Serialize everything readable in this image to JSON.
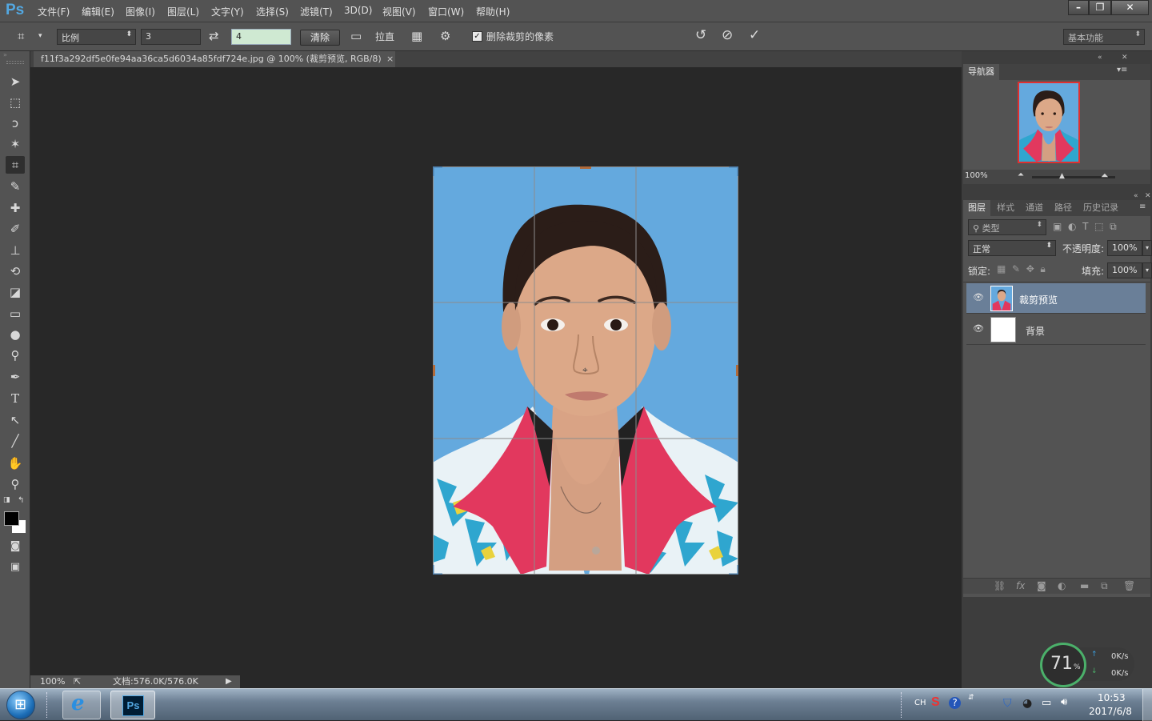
{
  "app": {
    "logo": "Ps"
  },
  "menu": [
    "文件(F)",
    "编辑(E)",
    "图像(I)",
    "图层(L)",
    "文字(Y)",
    "选择(S)",
    "滤镜(T)",
    "3D(D)",
    "视图(V)",
    "窗口(W)",
    "帮助(H)"
  ],
  "window_controls": {
    "minimize": "–",
    "restore": "❐",
    "close": "✕"
  },
  "options": {
    "ratio_select": "比例",
    "width_value": "3",
    "height_value": "4",
    "clear_label": "清除",
    "straighten_label": "拉直",
    "delete_cropped_label": "删除裁剪的像素",
    "delete_cropped_checked": true,
    "workspace_select": "基本功能"
  },
  "document": {
    "tab_title": "f11f3a292df5e0fe94aa36ca5d6034a85fdf724e.jpg @ 100% (裁剪预览, RGB/8)",
    "tab_close": "×"
  },
  "status": {
    "zoom": "100%",
    "doc_info": "文档:576.0K/576.0K"
  },
  "navigator": {
    "tab_label": "导航器",
    "zoom": "100%"
  },
  "layers_panel": {
    "tabs": [
      "图层",
      "样式",
      "通道",
      "路径",
      "历史记录"
    ],
    "filter_kind": "类型",
    "blend_mode": "正常",
    "opacity_label": "不透明度:",
    "opacity_value": "100%",
    "lock_label": "锁定:",
    "fill_label": "填充:",
    "fill_value": "100%",
    "layers": [
      {
        "name": "裁剪预览",
        "selected": true
      },
      {
        "name": "背景",
        "selected": false
      }
    ]
  },
  "speed_widget": {
    "percent": "71",
    "percent_unit": "%",
    "upload": "0K/s",
    "download": "0K/s"
  },
  "taskbar": {
    "ps_label": "Ps",
    "lang": "CH",
    "time": "10:53",
    "date": "2017/6/8"
  },
  "colors": {
    "ui_bg": "#535353",
    "canvas_bg": "#282828",
    "photo_bg": "#64a9de",
    "jacket_red": "#e2385e",
    "selected_layer": "#6a7f98",
    "accent": "#53a8e2"
  }
}
